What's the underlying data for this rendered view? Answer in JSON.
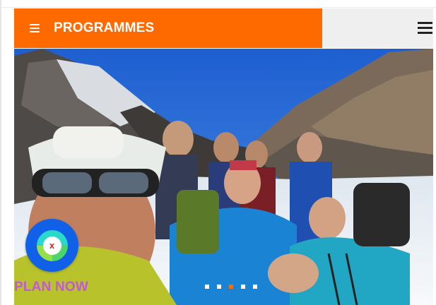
{
  "header": {
    "title": "PROGRAMMES",
    "menu_icon": "menu-icon",
    "hamburger_icon": "hamburger-icon",
    "accent_color": "#ff6a00"
  },
  "hero": {
    "image": "group-of-hikers-on-glacier-photo",
    "slides": {
      "count": 5,
      "active_index": 2
    }
  },
  "badge": {
    "icon": "app-logo-icon",
    "core_text": "x"
  },
  "cta": {
    "label": "PLAN NOW",
    "color": "#c25ad8"
  }
}
